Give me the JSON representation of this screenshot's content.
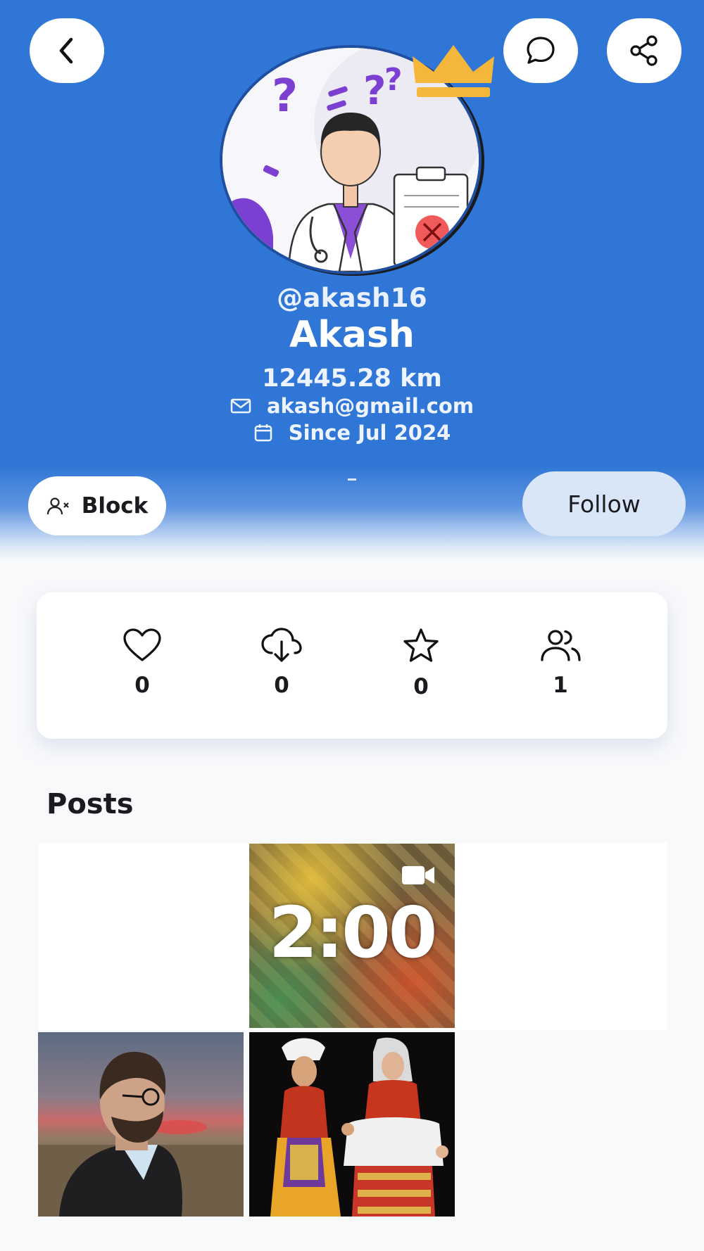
{
  "profile": {
    "username": "@akash16",
    "name": "Akash",
    "distance": "12445.28 km",
    "email": "akash@gmail.com",
    "since": "Since Jul 2024",
    "bio": "-"
  },
  "actions": {
    "block_label": "Block",
    "follow_label": "Follow"
  },
  "stats": [
    {
      "icon": "heart-icon",
      "value": "0"
    },
    {
      "icon": "cloud-download-icon",
      "value": "0"
    },
    {
      "icon": "star-icon",
      "value": "0"
    },
    {
      "icon": "users-icon",
      "value": "1"
    }
  ],
  "posts": {
    "title": "Posts",
    "items": [
      {
        "kind": "video",
        "overlay_text": "2:00"
      },
      {
        "kind": "photo"
      },
      {
        "kind": "photo"
      }
    ]
  },
  "colors": {
    "header_blue": "#2f76d6",
    "crown": "#f5b73b",
    "follow_bg": "#d9e6f8"
  }
}
